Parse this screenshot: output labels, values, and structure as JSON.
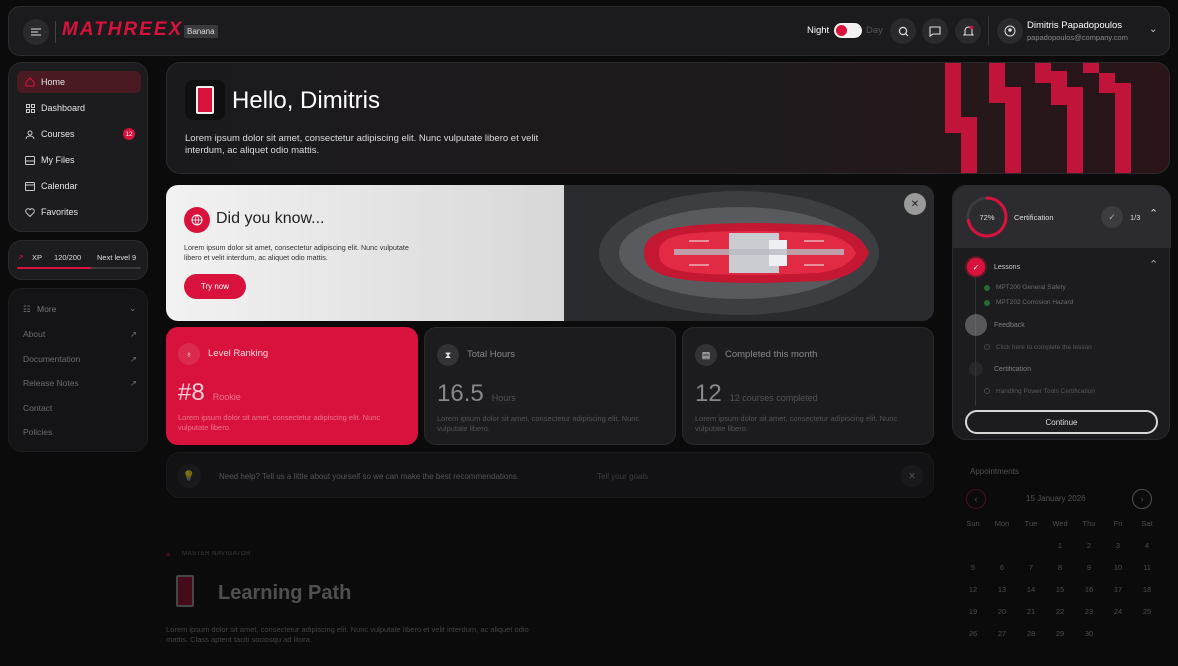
{
  "brand": {
    "logo": "MATHREEX",
    "tag": "Banana",
    "accent": "#d8123c"
  },
  "topbar": {
    "theme_night": "Night",
    "theme_day": "Day",
    "user_name": "Dimitris Papadopoulos",
    "user_email": "papadopoulos@company.com"
  },
  "nav": {
    "items": [
      {
        "label": "Home",
        "icon": "home-icon"
      },
      {
        "label": "Dashboard",
        "icon": "grid-icon"
      },
      {
        "label": "Courses",
        "icon": "courses-icon",
        "badge": "12"
      },
      {
        "label": "My Files",
        "icon": "files-icon"
      },
      {
        "label": "Calendar",
        "icon": "calendar-icon"
      },
      {
        "label": "Favorites",
        "icon": "heart-icon"
      }
    ]
  },
  "xp": {
    "label": "XP",
    "value": "120/200",
    "next": "Next level 9",
    "progress": 0.6
  },
  "more": {
    "title": "More",
    "items": [
      "About",
      "Documentation",
      "Release Notes",
      "Contact",
      "Policies"
    ]
  },
  "hero": {
    "greeting": "Hello, Dimitris",
    "text": "Lorem ipsum dolor sit amet, consectetur adipiscing elit. Nunc vulputate libero et velit interdum, ac aliquet odio mattis."
  },
  "dyk": {
    "title": "Did you know...",
    "text": "Lorem ipsum dolor sit amet, consectetur adipiscing elit. Nunc vulputate libero et velit interdum, ac aliquet odio mattis.",
    "button": "Try now"
  },
  "stats": [
    {
      "label": "Level Ranking",
      "value": "#8",
      "unit": "Rookie",
      "desc": "Lorem ipsum dolor sit amet, consectetur adipiscing elit. Nunc vulputate libero."
    },
    {
      "label": "Total Hours",
      "value": "16.5",
      "unit": "Hours",
      "desc": "Lorem ipsum dolor sit amet, consectetur adipiscing elit. Nunc vulputate libero."
    },
    {
      "label": "Completed this month",
      "value": "12",
      "unit": "12 courses completed",
      "desc": "Lorem ipsum dolor sit amet, consectetur adipiscing elit. Nunc vulputate libero."
    }
  ],
  "help": {
    "text": "Need help? Tell us a little about yourself so we can make the best recommendations.",
    "link": "Tell your goals"
  },
  "learning_path": {
    "eyebrow": "MASTER NAVIGATOR",
    "title": "Learning Path",
    "text": "Lorem ipsum dolor sit amet, consectetur adipiscing elit. Nunc vulputate libero et velit interdum, ac aliquet odio mattis. Class aptent taciti sociosqu ad litora."
  },
  "cert": {
    "percent": "72%",
    "progress": 0.72,
    "title": "Certification",
    "count": "1/3",
    "lessons_title": "Lessons",
    "lessons": [
      "MPT200 General Safety",
      "MPT202 Corrosion Hazard"
    ],
    "feedback_title": "Feedback",
    "feedback_item": "Click here to complete the lesson",
    "cert_title": "Certification",
    "cert_item": "Handling Power Tools Certification",
    "button": "Continue"
  },
  "appointments": {
    "title": "Appointments",
    "date": "15 January 2026",
    "days": [
      "Sun",
      "Mon",
      "Tue",
      "Wed",
      "Thu",
      "Fri",
      "Sat"
    ],
    "rows": [
      [
        "",
        "",
        "",
        "1",
        "2",
        "3",
        "4"
      ],
      [
        "5",
        "6",
        "7",
        "8",
        "9",
        "10",
        "11"
      ],
      [
        "12",
        "13",
        "14",
        "15",
        "16",
        "17",
        "18"
      ],
      [
        "19",
        "20",
        "21",
        "22",
        "23",
        "24",
        "25"
      ],
      [
        "26",
        "27",
        "28",
        "29",
        "30",
        "",
        ""
      ]
    ]
  }
}
